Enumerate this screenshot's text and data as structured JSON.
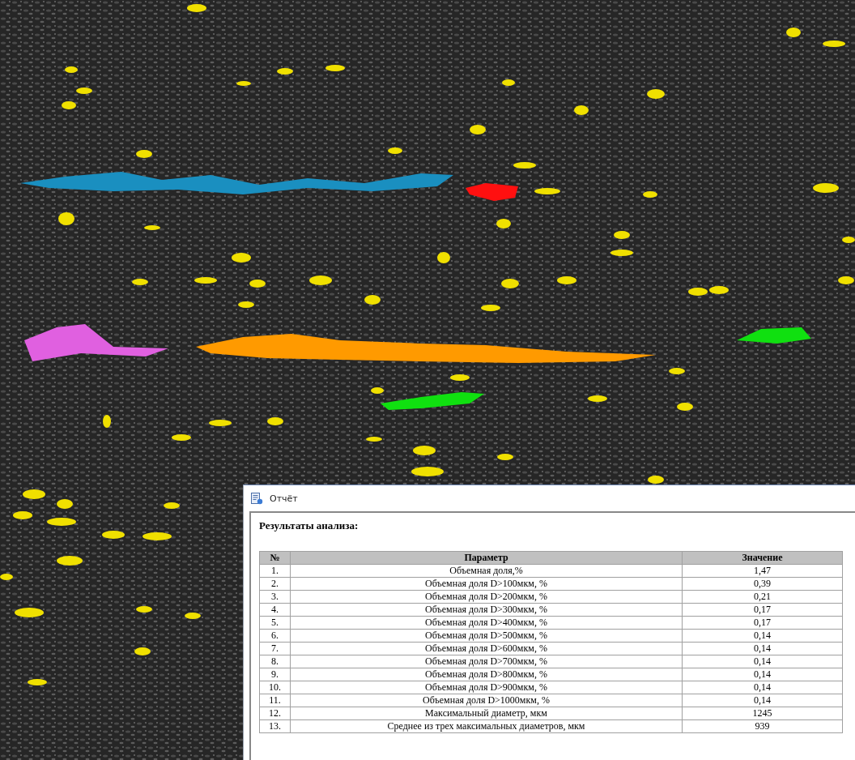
{
  "report_window": {
    "title": "Отчёт",
    "heading": "Результаты анализа:",
    "table": {
      "columns": [
        "№",
        "Параметр",
        "Значение"
      ],
      "rows": [
        {
          "number": "1.",
          "parameter": "Объемная доля,%",
          "value": "1,47"
        },
        {
          "number": "2.",
          "parameter": "Объемная доля D>100мкм, %",
          "value": "0,39"
        },
        {
          "number": "3.",
          "parameter": "Объемная доля D>200мкм, %",
          "value": "0,21"
        },
        {
          "number": "4.",
          "parameter": "Объемная доля D>300мкм, %",
          "value": "0,17"
        },
        {
          "number": "5.",
          "parameter": "Объемная доля D>400мкм, %",
          "value": "0,17"
        },
        {
          "number": "6.",
          "parameter": "Объемная доля D>500мкм, %",
          "value": "0,14"
        },
        {
          "number": "7.",
          "parameter": "Объемная доля D>600мкм, %",
          "value": "0,14"
        },
        {
          "number": "8.",
          "parameter": "Объемная доля D>700мкм, %",
          "value": "0,14"
        },
        {
          "number": "9.",
          "parameter": "Объемная доля D>800мкм, %",
          "value": "0,14"
        },
        {
          "number": "10.",
          "parameter": "Объемная доля D>900мкм, %",
          "value": "0,14"
        },
        {
          "number": "11.",
          "parameter": "Объемная доля D>1000мкм, %",
          "value": "0,14"
        },
        {
          "number": "12.",
          "parameter": "Максимальный диаметр, мкм",
          "value": "1245"
        },
        {
          "number": "13.",
          "parameter": "Среднее из трех максимальных диаметров, мкм",
          "value": "939"
        }
      ]
    }
  }
}
